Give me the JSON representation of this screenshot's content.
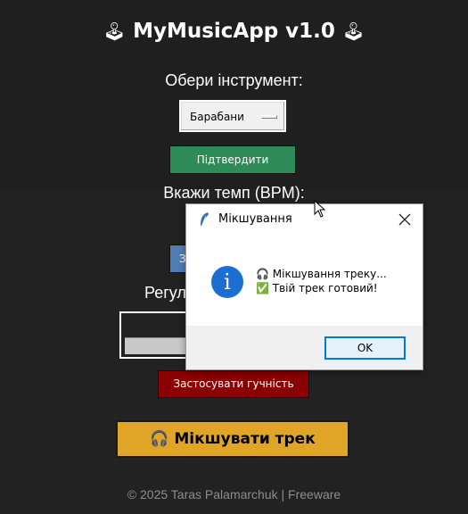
{
  "app": {
    "title": "MyMusicApp v1.0",
    "title_icon_left": "🕹",
    "title_icon_right": "🕹"
  },
  "instrument": {
    "label": "Обери інструмент:",
    "selected": "Барабани",
    "confirm_label": "Підтвердити"
  },
  "tempo": {
    "label": "Вкажи темп (BPM):",
    "apply_label_partial": "З"
  },
  "volume": {
    "label_partial": "Регул",
    "apply_label": "Застосувати гучність"
  },
  "mix": {
    "icon": "🎧",
    "label": "Мікшувати трек"
  },
  "footer": {
    "text": "© 2025 Taras Palamarchuk | Freeware"
  },
  "dialog": {
    "title": "Мікшування",
    "line1": "🎧 Мікшування треку...",
    "line2": "✅ Твій трек готовий!",
    "ok_label": "OK",
    "info_icon": "i"
  },
  "colors": {
    "background": "#222222",
    "confirm": "#2e8b57",
    "apply_volume": "#8b0000",
    "mix": "#e0a527",
    "info": "#1c6fd1",
    "ok_border": "#0078d7"
  }
}
